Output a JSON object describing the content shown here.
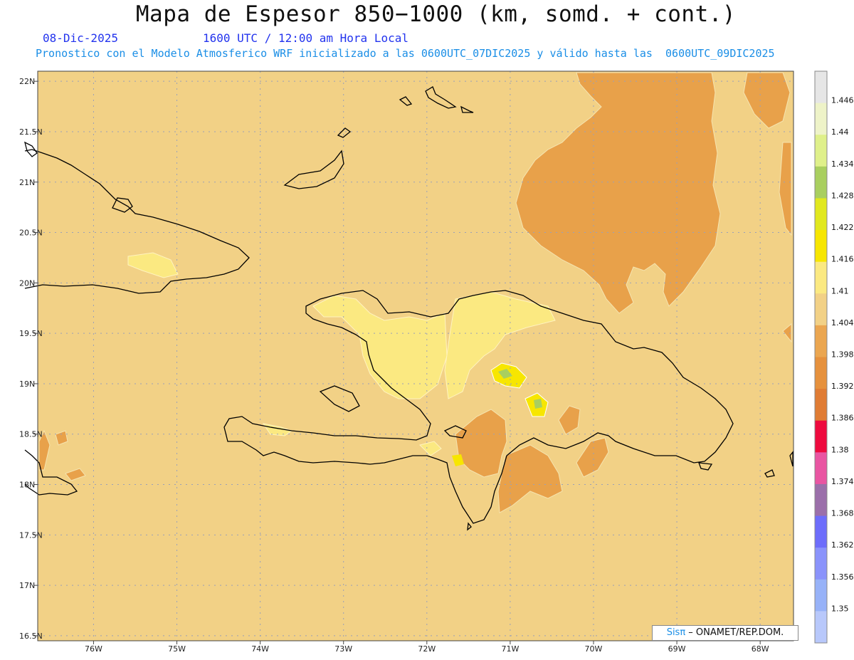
{
  "header": {
    "title": "Mapa de Espesor 850−1000 (km, somd. + cont.)",
    "date": "08-Dic-2025",
    "time": "1600 UTC / 12:00 am Hora Local",
    "forecast": "Pronostico con el Modelo Atmosferico WRF inicializado a las 0600UTC_07DIC2025 y válido hasta las  0600UTC_09DIC2025"
  },
  "map": {
    "lat_labels": [
      "22N",
      "21.5N",
      "21N",
      "20.5N",
      "20N",
      "19.5N",
      "19N",
      "18.5N",
      "18N",
      "17.5N",
      "17N",
      "16.5N"
    ],
    "lon_labels": [
      "76W",
      "75W",
      "74W",
      "73W",
      "72W",
      "71W",
      "70W",
      "69W",
      "68W"
    ],
    "lat_range": [
      16.45,
      22.1
    ],
    "lon_range": [
      -76.67,
      -67.6
    ],
    "background_color": "#f2d186",
    "coast_color": "#000000"
  },
  "colorbar": {
    "labels": [
      "1.446",
      "1.44",
      "1.434",
      "1.428",
      "1.422",
      "1.416",
      "1.41",
      "1.404",
      "1.398",
      "1.392",
      "1.386",
      "1.38",
      "1.374",
      "1.368",
      "1.362",
      "1.356",
      "1.35"
    ],
    "colors": [
      "#e6e6e6",
      "#eef3c8",
      "#dff08a",
      "#a9cf5f",
      "#e1e81e",
      "#f7e600",
      "#fbe981",
      "#f2d186",
      "#eba650",
      "#e6913d",
      "#e07c34",
      "#ee0a3e",
      "#e955a2",
      "#9b6faa",
      "#6d6dfb",
      "#8a93fb",
      "#97b2f8",
      "#b8c8fb"
    ]
  },
  "credit": {
    "sis": "Sisπ",
    "text": " – ONAMET/REP.DOM."
  }
}
